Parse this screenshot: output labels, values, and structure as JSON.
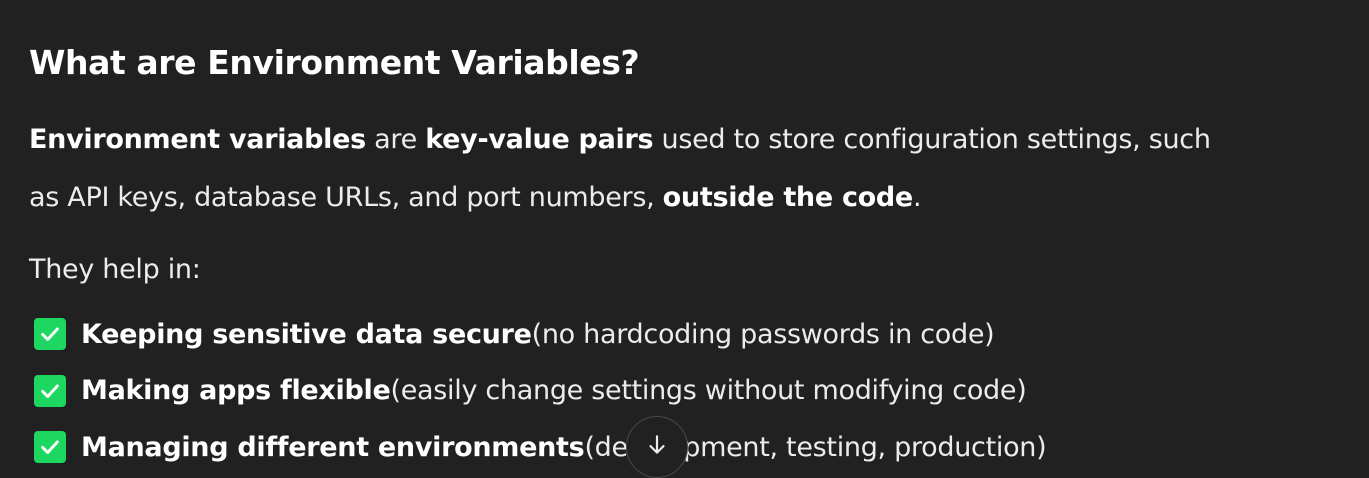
{
  "heading": "What are Environment Variables?",
  "definition": {
    "term": "Environment variables",
    "text1": " are ",
    "key_phrase": "key-value pairs",
    "text2": " used to store configuration settings, such",
    "text3": "as API keys, database URLs, and port numbers, ",
    "emphasis": "outside the code",
    "text4": "."
  },
  "intro": "They help in:",
  "benefits": [
    {
      "icon": "check-mark-icon",
      "bold": "Keeping sensitive data secure",
      "rest": " (no hardcoding passwords in code)"
    },
    {
      "icon": "check-mark-icon",
      "bold": "Making apps flexible",
      "rest": " (easily change settings without modifying code)"
    },
    {
      "icon": "check-mark-icon",
      "bold": "Managing different environments",
      "rest": " (development, testing, production)"
    }
  ],
  "scroll_button": {
    "icon": "arrow-down-icon"
  },
  "colors": {
    "background": "#212121",
    "text": "#ececec",
    "check": "#1ed760"
  }
}
